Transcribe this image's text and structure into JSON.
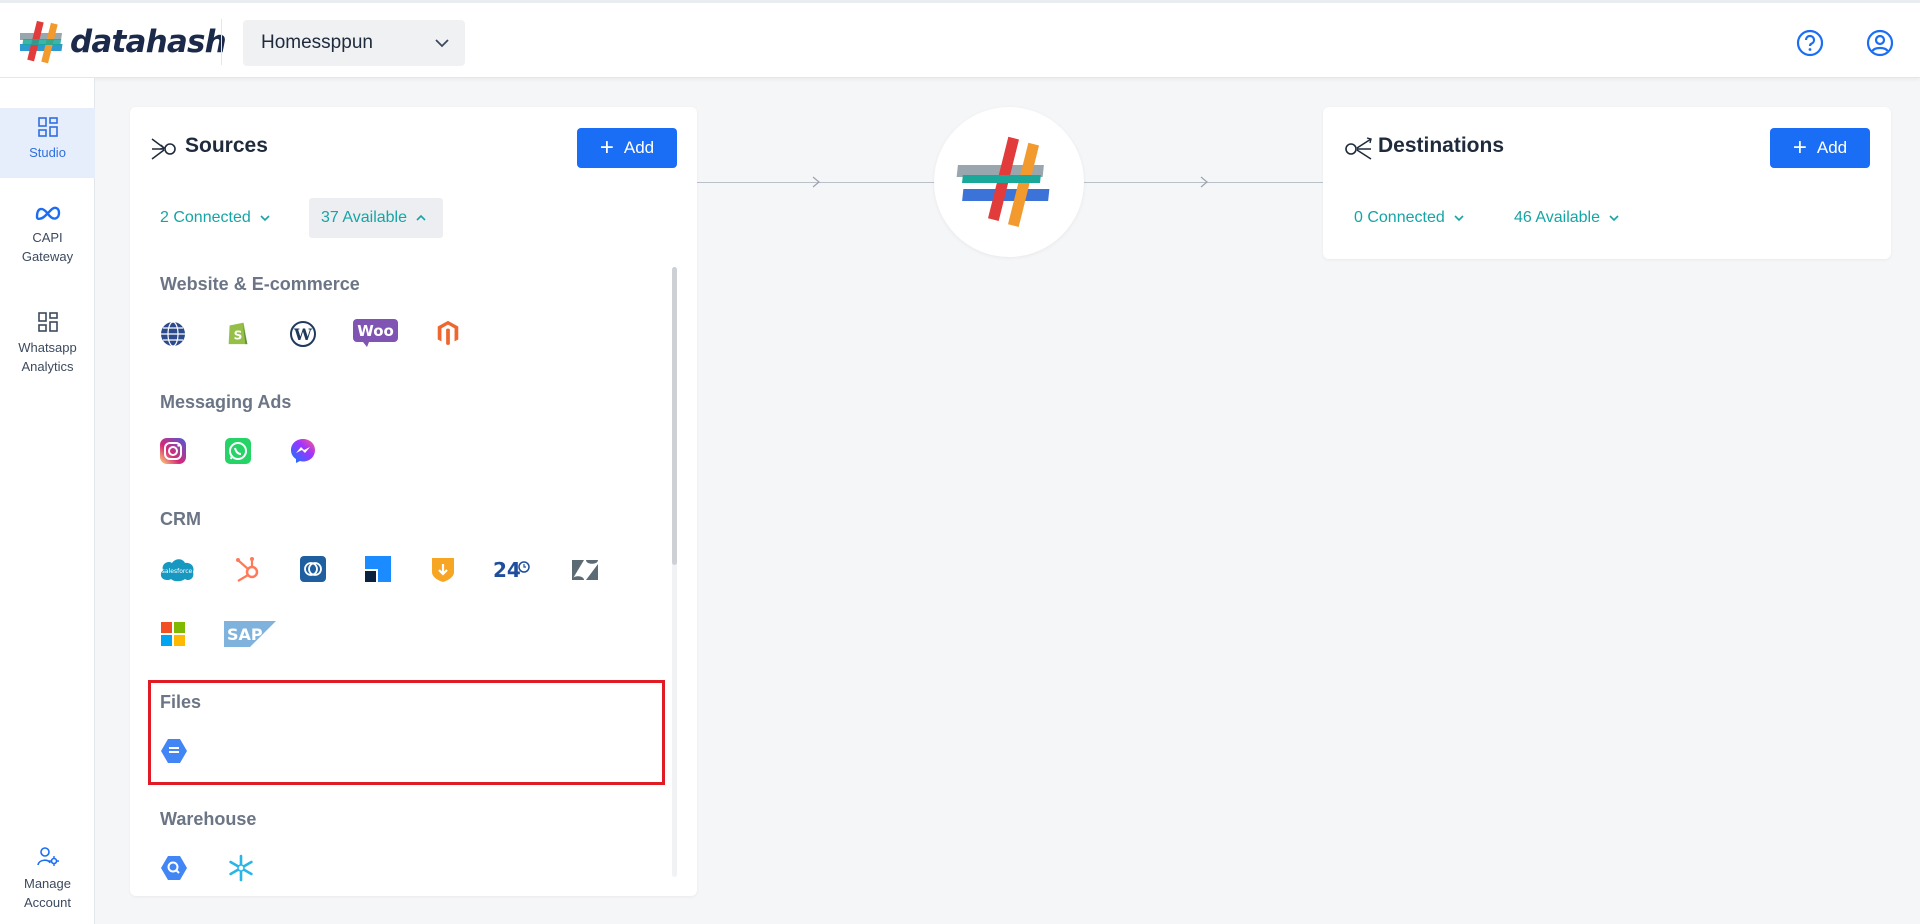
{
  "header": {
    "logo_text": "datahash",
    "workspace": "Homessppun",
    "help_icon": "help-circle-icon",
    "account_icon": "user-circle-icon"
  },
  "sidebar": {
    "items": [
      {
        "label": "Studio",
        "icon": "grid-icon",
        "active": true
      },
      {
        "label": "CAPI Gateway",
        "icon": "meta-icon"
      },
      {
        "label": "Whatsapp Analytics",
        "icon": "grid-icon"
      }
    ],
    "bottom": {
      "label": "Manage Account",
      "icon": "user-settings-icon"
    }
  },
  "sources": {
    "title": "Sources",
    "add_label": "Add",
    "connected_label": "2 Connected",
    "available_label": "37 Available",
    "categories": [
      {
        "name": "Website & E-commerce",
        "items": [
          "globe",
          "shopify",
          "wordpress",
          "woocommerce",
          "magento"
        ]
      },
      {
        "name": "Messaging Ads",
        "items": [
          "instagram",
          "whatsapp",
          "messenger"
        ]
      },
      {
        "name": "CRM",
        "items": [
          "salesforce",
          "hubspot",
          "zoho",
          "freshsales",
          "pipedrive",
          "24",
          "zendesk",
          "microsoft",
          "sap"
        ]
      },
      {
        "name": "Files",
        "items": [
          "google-sheets"
        ]
      },
      {
        "name": "Warehouse",
        "items": [
          "bigquery",
          "snowflake"
        ]
      }
    ]
  },
  "destinations": {
    "title": "Destinations",
    "add_label": "Add",
    "connected_label": "0 Connected",
    "available_label": "46 Available"
  },
  "crm_24_text": "24",
  "woo_text": "Woo",
  "sap_text": "SAP",
  "colors": {
    "accent": "#1a6ef5",
    "teal": "#16a5a5",
    "highlight": "#e01b24"
  }
}
